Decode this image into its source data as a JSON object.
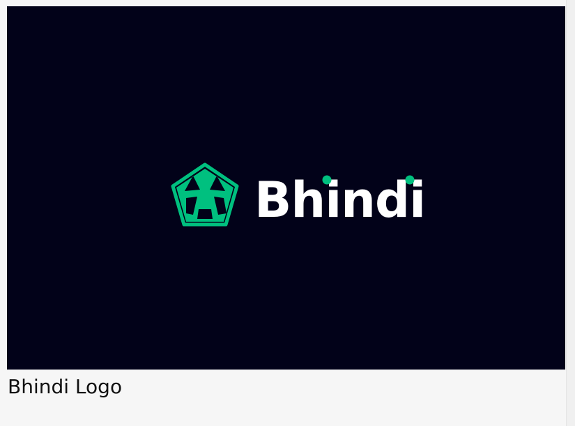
{
  "image": {
    "background_color": "#020219",
    "logo": {
      "wordmark": "Bhindi",
      "wordmark_color": "#ffffff",
      "accent_color": "#00c07f",
      "icon": "pentagon-mesh-icon"
    }
  },
  "caption": {
    "text": "Bhindi Logo"
  }
}
